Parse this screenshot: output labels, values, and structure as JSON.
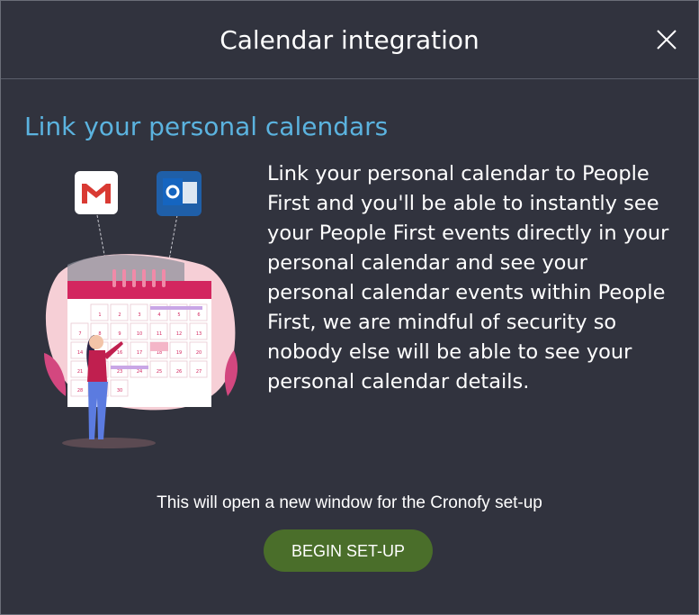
{
  "dialog": {
    "title": "Calendar integration",
    "close_icon": "close-icon"
  },
  "content": {
    "heading": "Link your personal calendars",
    "description": "Link your personal calendar to People First and you'll be able to instantly see your People First events directly in your personal calendar and see your personal calendar events within People First, we are mindful of security so nobody else will be able to see your personal calendar details.",
    "illustration": {
      "icons": [
        "gmail-icon",
        "outlook-icon"
      ],
      "calendar_days": [
        "1",
        "2",
        "3",
        "4",
        "5",
        "6",
        "7",
        "8",
        "9",
        "10",
        "11",
        "12",
        "13",
        "14",
        "15",
        "16",
        "17",
        "18",
        "19",
        "20",
        "21",
        "22",
        "23",
        "24",
        "25",
        "26",
        "27",
        "28",
        "29",
        "30"
      ]
    }
  },
  "footer": {
    "note": "This will open a new window for the Cronofy set-up",
    "begin_label": "BEGIN SET-UP"
  },
  "colors": {
    "background": "#31333e",
    "heading": "#5bb3df",
    "button": "#4a6e2a",
    "calendar_accent": "#d3265f"
  }
}
